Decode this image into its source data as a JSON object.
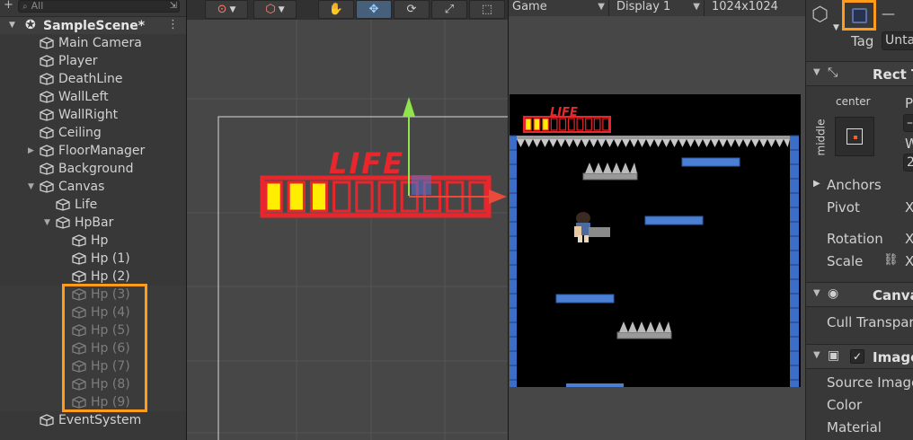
{
  "hierarchy": {
    "search_placeholder": "All",
    "scene_name": "SampleScene*",
    "items": [
      {
        "label": "Main Camera"
      },
      {
        "label": "Player"
      },
      {
        "label": "DeathLine"
      },
      {
        "label": "WallLeft"
      },
      {
        "label": "WallRight"
      },
      {
        "label": "Ceiling"
      },
      {
        "label": "FloorManager"
      },
      {
        "label": "Background"
      },
      {
        "label": "Canvas"
      },
      {
        "label": "Life"
      },
      {
        "label": "HpBar"
      },
      {
        "label": "Hp"
      },
      {
        "label": "Hp (1)"
      },
      {
        "label": "Hp (2)"
      },
      {
        "label": "Hp (3)"
      },
      {
        "label": "Hp (4)"
      },
      {
        "label": "Hp (5)"
      },
      {
        "label": "Hp (6)"
      },
      {
        "label": "Hp (7)"
      },
      {
        "label": "Hp (8)"
      },
      {
        "label": "Hp (9)"
      },
      {
        "label": "EventSystem"
      }
    ],
    "inactive_items": [
      "Hp (3)",
      "Hp (4)",
      "Hp (5)",
      "Hp (6)",
      "Hp (7)",
      "Hp (8)",
      "Hp (9)"
    ]
  },
  "scene_view": {
    "life_label": "LIFE",
    "hp_filled": 3,
    "hp_total": 10,
    "tools": [
      "hand-tool",
      "move-tool",
      "rotate-tool",
      "scale-tool",
      "rect-tool"
    ],
    "active_tool": "move-tool"
  },
  "game_view": {
    "tab": "Game",
    "display": "Display 1",
    "resolution": "1024x1024",
    "life_label": "LIFE",
    "hp_filled": 3,
    "hp_total": 10
  },
  "inspector": {
    "tag_label": "Tag",
    "tag_value": "Unta",
    "rect_transform": "Rect T",
    "anchor_h": "center",
    "anchor_v": "middle",
    "p_label": "P",
    "w_label": "W",
    "w_value": "2",
    "anchors_label": "Anchors",
    "pivot_label": "Pivot",
    "pivot_x": "X",
    "rotation_label": "Rotation",
    "rotation_x": "X",
    "scale_label": "Scale",
    "scale_x": "X",
    "canvas_renderer": "Canva",
    "cull_label": "Cull Transpar",
    "image_label": "Image",
    "source_label": "Source Image",
    "color_label": "Color",
    "material_label": "Material"
  },
  "colors": {
    "highlight": "#ff9c1b",
    "hp_fill": "#ffee00",
    "hp_frame": "#e8262b",
    "move_y": "#8ee44a"
  }
}
